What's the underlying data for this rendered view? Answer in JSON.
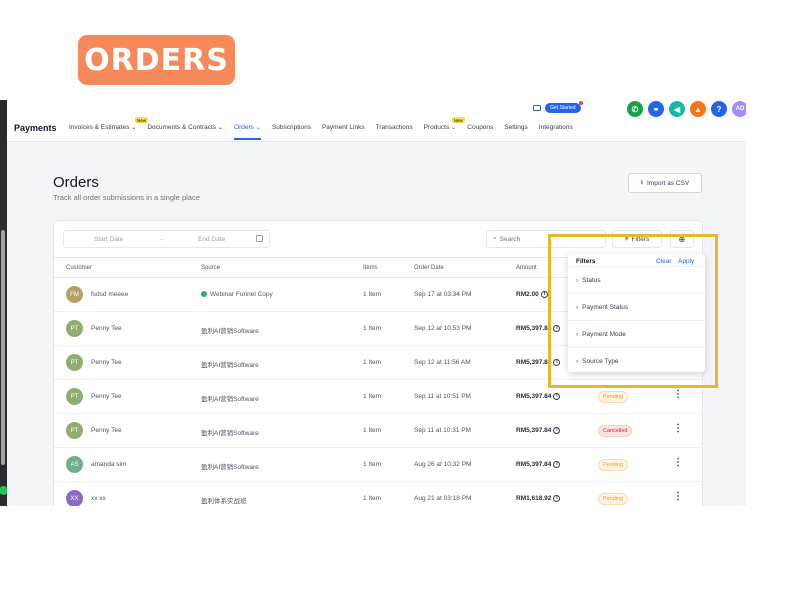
{
  "badge": {
    "label": "ORDERS"
  },
  "nav": {
    "brand": "Payments",
    "items": [
      {
        "label": "Invoices & Estimates",
        "dropdown": true,
        "badge": "New"
      },
      {
        "label": "Documents & Contracts",
        "dropdown": true
      },
      {
        "label": "Orders",
        "dropdown": true,
        "active": true
      },
      {
        "label": "Subscriptions"
      },
      {
        "label": "Payment Links"
      },
      {
        "label": "Transactions"
      },
      {
        "label": "Products",
        "dropdown": true,
        "badge": "New"
      },
      {
        "label": "Coupons"
      },
      {
        "label": "Settings"
      },
      {
        "label": "Integrations"
      }
    ],
    "get_started": "Get Started",
    "user_initials": "AD",
    "help": "?"
  },
  "page": {
    "title": "Orders",
    "subtitle": "Track all order submissions in a single place",
    "import_label": "Import as CSV"
  },
  "toolbar": {
    "start_date": "Start Date",
    "end_date": "End Date",
    "arrow": "→",
    "search_placeholder": "Search",
    "filters_label": "Filters"
  },
  "table": {
    "headers": [
      "Customer",
      "Source",
      "Items",
      "Order Date",
      "Amount"
    ],
    "rows": [
      {
        "initials": "FM",
        "avatar_color": "#b5a06a",
        "customer": "fsdsd meeee",
        "source": "Webinar Funnel Copy",
        "web_icon": true,
        "items": "1 Item",
        "date": "Sep 17 at 03:34 PM",
        "amount": "RM2.00",
        "status": ""
      },
      {
        "initials": "PT",
        "avatar_color": "#8fae6e",
        "customer": "Penny Tee",
        "source": "盈利AI营销Software",
        "items": "1 Item",
        "date": "Sep 12 at 10:53 PM",
        "amount": "RM5,397.84",
        "status": ""
      },
      {
        "initials": "PT",
        "avatar_color": "#8fae6e",
        "customer": "Penny Tee",
        "source": "盈利AI营销Software",
        "items": "1 Item",
        "date": "Sep 12 at 11:56 AM",
        "amount": "RM5,397.84",
        "status": ""
      },
      {
        "initials": "PT",
        "avatar_color": "#8fae6e",
        "customer": "Penny Tee",
        "source": "盈利AI营销Software",
        "items": "1 Item",
        "date": "Sep 11 at 10:51 PM",
        "amount": "RM5,397.84",
        "status": "Pending",
        "status_kind": "pending"
      },
      {
        "initials": "PT",
        "avatar_color": "#8fae6e",
        "customer": "Penny Tee",
        "source": "盈利AI营销Software",
        "items": "1 Item",
        "date": "Sep 11 at 10:31 PM",
        "amount": "RM5,397.84",
        "status": "Cancelled",
        "status_kind": "cancelled"
      },
      {
        "initials": "AS",
        "avatar_color": "#6fae8a",
        "customer": "amanda sim",
        "source": "盈利AI营销Software",
        "items": "1 Item",
        "date": "Aug 26 at 10:32 PM",
        "amount": "RM5,397.84",
        "status": "Pending",
        "status_kind": "pending"
      },
      {
        "initials": "XX",
        "avatar_color": "#8b6bbf",
        "customer": "xx xx",
        "source": "盈利体系实战班",
        "items": "1 Item",
        "date": "Aug 21 at 03:18 PM",
        "amount": "RM1,618.92",
        "status": "Pending",
        "status_kind": "pending"
      }
    ]
  },
  "filters_panel": {
    "title": "Filters",
    "clear": "Clear",
    "apply": "Apply",
    "items": [
      "Status",
      "Payment Status",
      "Payment Mode",
      "Source Type"
    ]
  },
  "colors": {
    "accent": "#2563eb",
    "highlight": "#e6b82a",
    "badge_bg": "#f5895a"
  }
}
